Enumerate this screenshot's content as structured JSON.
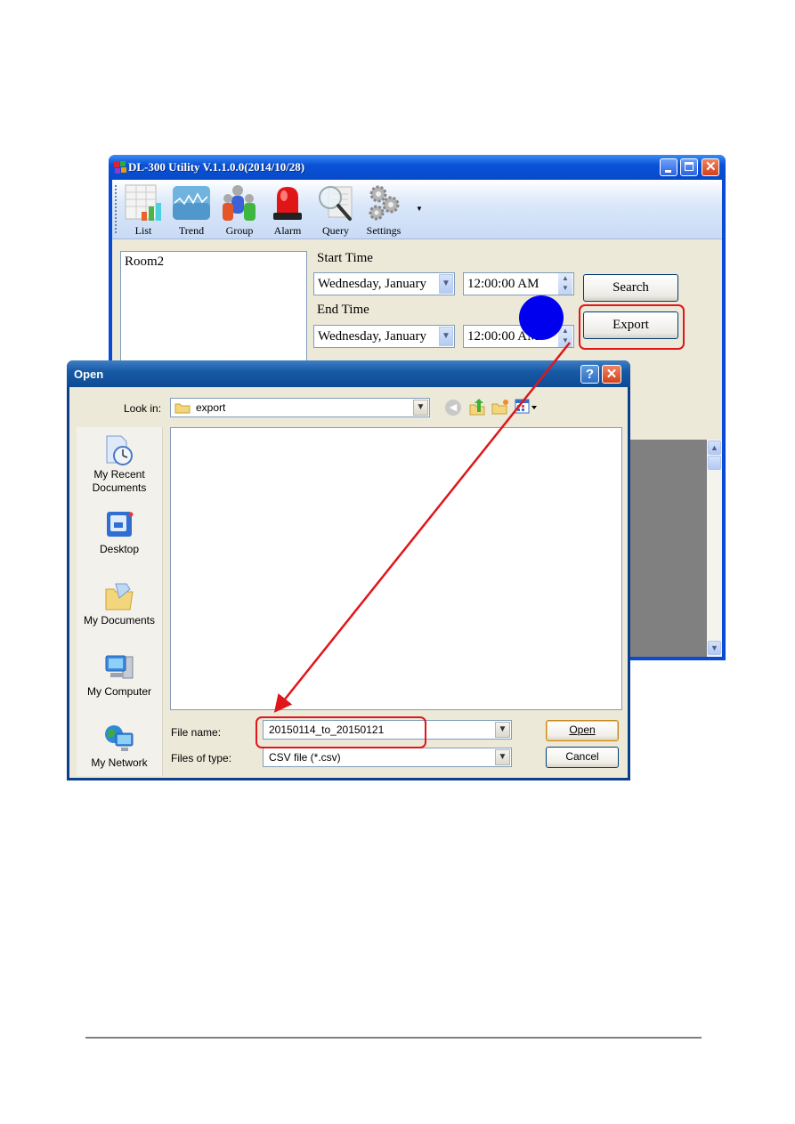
{
  "app": {
    "title": "DL-300 Utility V.1.1.0.0(2014/10/28)",
    "toolbar": [
      {
        "label": "List",
        "icon": "list-chart-icon"
      },
      {
        "label": "Trend",
        "icon": "trend-icon"
      },
      {
        "label": "Group",
        "icon": "group-icon"
      },
      {
        "label": "Alarm",
        "icon": "alarm-siren-icon"
      },
      {
        "label": "Query",
        "icon": "magnifier-icon"
      },
      {
        "label": "Settings",
        "icon": "gears-icon"
      }
    ],
    "rooms": [
      "Room2"
    ],
    "start_time_label": "Start Time",
    "end_time_label": "End Time",
    "start_date": "Wednesday,  January",
    "start_time": "12:00:00 AM",
    "end_date": "Wednesday,  January",
    "end_time": "12:00:00 AM",
    "search_label": "Search",
    "export_label": "Export"
  },
  "dialog": {
    "title": "Open",
    "look_in_label": "Look in:",
    "look_in_value": "export",
    "places": [
      {
        "label": "My Recent Documents",
        "icon": "recent-documents-icon"
      },
      {
        "label": "Desktop",
        "icon": "desktop-icon"
      },
      {
        "label": "My Documents",
        "icon": "my-documents-icon"
      },
      {
        "label": "My Computer",
        "icon": "my-computer-icon"
      },
      {
        "label": "My Network",
        "icon": "my-network-icon"
      }
    ],
    "file_name_label": "File name:",
    "file_name_value": "20150114_to_20150121",
    "file_type_label": "Files of type:",
    "file_type_value": "CSV file (*.csv)",
    "open_label": "Open",
    "cancel_label": "Cancel"
  },
  "annotation": {
    "highlight_color": "#e0161b",
    "marker_color": "#0000ee"
  }
}
